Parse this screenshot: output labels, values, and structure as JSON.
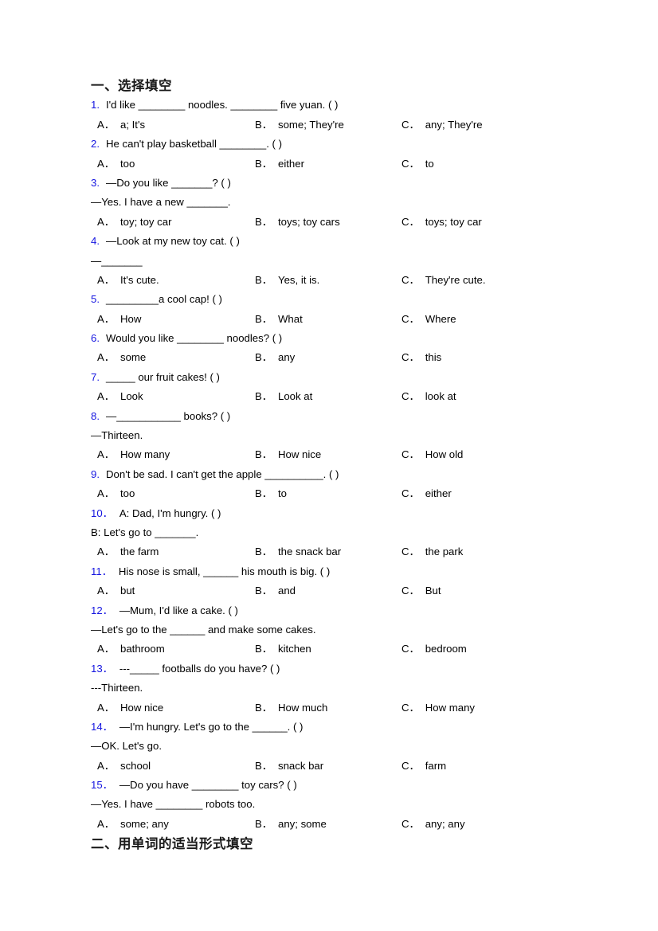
{
  "document": {
    "section1_heading": "一、选择填空",
    "section2_heading": "二、用单词的适当形式填空",
    "number_color": "#1616e0",
    "option_letters": {
      "a": "A．",
      "b": "B．",
      "c": "C．"
    }
  },
  "questions": [
    {
      "num": "1.",
      "stem_before": "I'd like ",
      "blank1": "________",
      "stem_mid": " noodles. ",
      "blank2": "________",
      "stem_after": " five yuan. (  )",
      "text": "I'd like ________ noodles. ________ five yuan. (  )",
      "continuation": null,
      "options": {
        "a": "a; It's",
        "b": "some; They're",
        "c": "any; They're"
      }
    },
    {
      "num": "2.",
      "text": "He can't play basketball ________. (   )",
      "continuation": null,
      "options": {
        "a": "too",
        "b": "either",
        "c": "to"
      }
    },
    {
      "num": "3.",
      "text": "—Do you like _______? (  )",
      "continuation": "—Yes. I have a new _______.",
      "options": {
        "a": "toy; toy car",
        "b": "toys; toy cars",
        "c": "toys; toy car"
      }
    },
    {
      "num": "4.",
      "text": "—Look at my new toy cat. (  )",
      "continuation": "—_______",
      "options": {
        "a": "It's cute.",
        "b": "Yes, it is.",
        "c": "They're cute."
      }
    },
    {
      "num": "5.",
      "text": "_________a cool cap! (  )",
      "continuation": null,
      "options": {
        "a": "How",
        "b": "What",
        "c": "Where"
      }
    },
    {
      "num": "6.",
      "text": "Would you like ________ noodles? (  )",
      "continuation": null,
      "options": {
        "a": "some",
        "b": "any",
        "c": "this"
      }
    },
    {
      "num": "7.",
      "text": "_____ our fruit cakes! (  )",
      "continuation": null,
      "options": {
        "a": "Look",
        "b": "Look at",
        "c": "look at"
      }
    },
    {
      "num": "8.",
      "text": "—___________ books? (  )",
      "continuation": "—Thirteen.",
      "options": {
        "a": "How many",
        "b": "How nice",
        "c": "How old"
      }
    },
    {
      "num": "9.",
      "text": "Don't be sad. I can't get the apple __________. (  )",
      "continuation": null,
      "options": {
        "a": "too",
        "b": "to",
        "c": "either"
      }
    },
    {
      "num": "10．",
      "text": "A: Dad, I'm hungry. (   )",
      "continuation": "B: Let's go to _______.",
      "options": {
        "a": "the farm",
        "b": "the snack bar",
        "c": "the park"
      }
    },
    {
      "num": "11．",
      "text": "His nose is small, ______ his mouth is big. (   )",
      "continuation": null,
      "options": {
        "a": "but",
        "b": "and",
        "c": "But"
      }
    },
    {
      "num": "12．",
      "text": "—Mum, I'd like a cake. (   )",
      "continuation": "—Let's go to the ______ and make some cakes.",
      "options": {
        "a": "bathroom",
        "b": "kitchen",
        "c": "bedroom"
      }
    },
    {
      "num": "13．",
      "text": "---_____ footballs do you have? (  )",
      "continuation": "---Thirteen.",
      "options": {
        "a": "How nice",
        "b": "How much",
        "c": "How many"
      }
    },
    {
      "num": "14．",
      "text": "—I'm hungry. Let's go to the ______. (  )",
      "continuation": "—OK. Let's go.",
      "options": {
        "a": "school",
        "b": "snack bar",
        "c": "farm"
      }
    },
    {
      "num": "15．",
      "text": "—Do you have ________ toy cars? (  )",
      "continuation": "—Yes. I have ________ robots too.",
      "options": {
        "a": "some; any",
        "b": "any; some",
        "c": "any; any"
      }
    }
  ]
}
